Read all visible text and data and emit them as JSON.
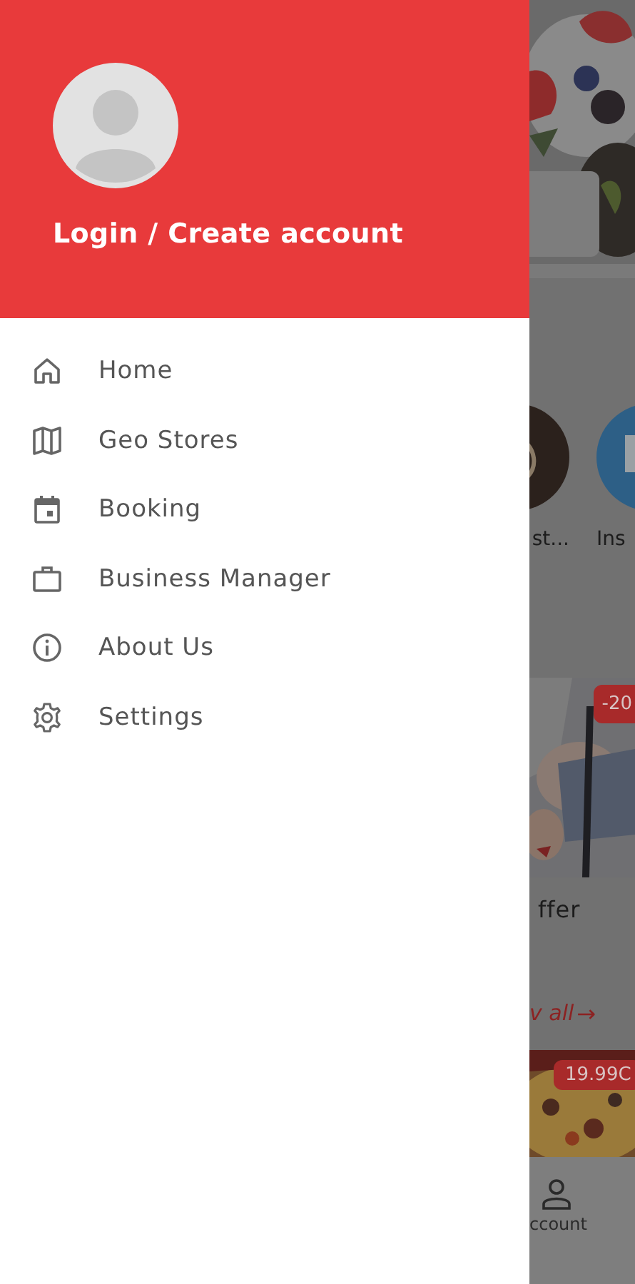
{
  "drawer": {
    "account_label": "Login / Create account",
    "menu": [
      {
        "label": "Home"
      },
      {
        "label": "Geo Stores"
      },
      {
        "label": "Booking"
      },
      {
        "label": "Business Manager"
      },
      {
        "label": "About Us"
      },
      {
        "label": "Settings"
      }
    ]
  },
  "background": {
    "categories": [
      {
        "label": "st..."
      },
      {
        "label": "Ins"
      }
    ],
    "offer": {
      "badge": "-20",
      "title": "ffer",
      "link": "v all",
      "link_icon": "→"
    },
    "product": {
      "price": "19.99C"
    },
    "nav": {
      "label": "ccount"
    }
  }
}
